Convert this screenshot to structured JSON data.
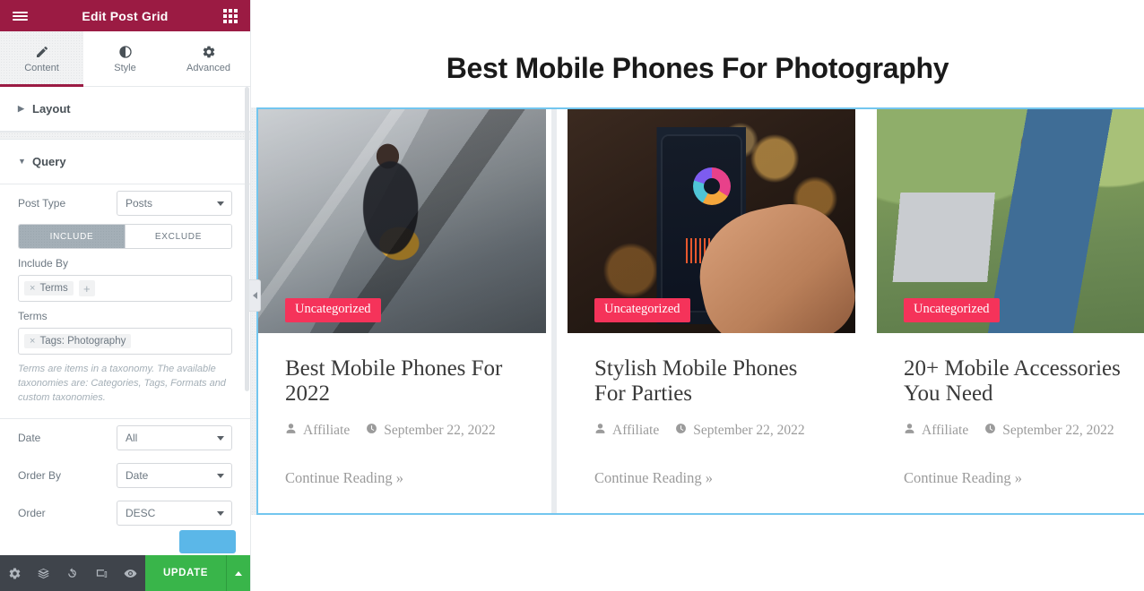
{
  "panel": {
    "header": {
      "title": "Edit Post Grid",
      "menu_icon": "hamburger-menu-icon",
      "grid_icon": "apps-grid-icon"
    },
    "tabs": [
      {
        "label": "Content",
        "icon": "pencil-icon",
        "active": true
      },
      {
        "label": "Style",
        "icon": "contrast-half-circle-icon",
        "active": false
      },
      {
        "label": "Advanced",
        "icon": "gear-icon",
        "active": false
      }
    ],
    "sections": [
      {
        "label": "Layout",
        "expanded": false
      },
      {
        "label": "Query",
        "expanded": true
      }
    ],
    "query": {
      "post_type": {
        "label": "Post Type",
        "value": "Posts"
      },
      "include_exclude": {
        "include_label": "INCLUDE",
        "exclude_label": "EXCLUDE",
        "selected": "INCLUDE"
      },
      "include_by": {
        "label": "Include By",
        "tokens": [
          {
            "text": "Terms",
            "remove": "×"
          }
        ],
        "add_symbol": "+"
      },
      "terms": {
        "label": "Terms",
        "tokens": [
          {
            "text": "Tags: Photography",
            "remove": "×"
          }
        ],
        "help": "Terms are items in a taxonomy. The available taxonomies are: Categories, Tags, Formats and custom taxonomies."
      },
      "date": {
        "label": "Date",
        "value": "All"
      },
      "order_by": {
        "label": "Order By",
        "value": "Date"
      },
      "order": {
        "label": "Order",
        "value": "DESC"
      }
    },
    "footer": {
      "icons": [
        "settings-gear-icon",
        "layers-navigator-icon",
        "history-revisions-icon",
        "responsive-mode-icon",
        "preview-eye-icon"
      ],
      "update_label": "UPDATE",
      "update_caret_icon": "caret-up-icon"
    },
    "collapse_handle_icon": "chevron-left-icon"
  },
  "canvas": {
    "page_title": "Best Mobile Phones For Photography",
    "cards": [
      {
        "badge": "Uncategorized",
        "title": "Best Mobile Phones For 2022",
        "author": "Affiliate",
        "date": "September 22, 2022",
        "read_more": "Continue Reading »",
        "author_icon": "user-icon",
        "date_icon": "clock-icon",
        "image_alt": "woman-on-escalator-with-phone"
      },
      {
        "badge": "Uncategorized",
        "title": "Stylish Mobile Phones For Parties",
        "author": "Affiliate",
        "date": "September 22, 2022",
        "read_more": "Continue Reading »",
        "author_icon": "user-icon",
        "date_icon": "clock-icon",
        "image_alt": "hand-holding-phone-with-chart-at-night"
      },
      {
        "badge": "Uncategorized",
        "title": "20+ Mobile Accessories You Need",
        "author": "Affiliate",
        "date": "September 22, 2022",
        "read_more": "Continue Reading »",
        "author_icon": "user-icon",
        "date_icon": "clock-icon",
        "image_alt": "man-with-laptop-and-phone-outdoors"
      }
    ]
  },
  "colors": {
    "panel_header": "#9b1b43",
    "badge": "#f5335a",
    "update_button": "#39b54a",
    "footer_bar": "#3f444b",
    "selection_outline": "#73c6ef",
    "toggle_active": "#a4afb7"
  }
}
